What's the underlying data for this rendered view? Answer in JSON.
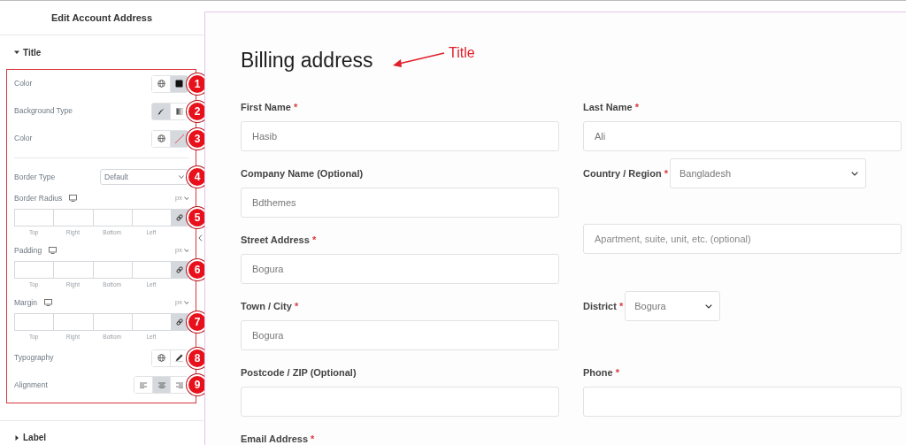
{
  "panel": {
    "title": "Edit Account Address",
    "sections": [
      {
        "label": "Title",
        "expanded": true,
        "controls": [
          {
            "kind": "toggles",
            "label": "Color",
            "callout": "1",
            "buttons": [
              {
                "kind": "global"
              },
              {
                "kind": "swatch",
                "color": "#111111"
              }
            ]
          },
          {
            "kind": "toggles",
            "label": "Background Type",
            "callout": "2",
            "buttons": [
              {
                "kind": "classic",
                "selected": true
              },
              {
                "kind": "gradient",
                "selected": false
              }
            ]
          },
          {
            "kind": "toggles",
            "label": "Color",
            "callout": "3",
            "buttons": [
              {
                "kind": "global"
              },
              {
                "kind": "empty-swatch"
              }
            ]
          },
          {
            "kind": "separator"
          },
          {
            "kind": "select",
            "label": "Border Type",
            "value": "Default",
            "callout": "4"
          },
          {
            "kind": "dimensions",
            "label": "Border Radius",
            "unit": "px",
            "sides": [
              "Top",
              "Right",
              "Bottom",
              "Left"
            ],
            "callout": "5"
          },
          {
            "kind": "dimensions",
            "label": "Padding",
            "unit": "px",
            "sides": [
              "Top",
              "Right",
              "Bottom",
              "Left"
            ],
            "callout": "6"
          },
          {
            "kind": "dimensions",
            "label": "Margin",
            "unit": "px",
            "sides": [
              "Top",
              "Right",
              "Bottom",
              "Left"
            ],
            "callout": "7"
          },
          {
            "kind": "toggles",
            "label": "Typography",
            "callout": "8",
            "buttons": [
              {
                "kind": "global"
              },
              {
                "kind": "edit"
              }
            ]
          },
          {
            "kind": "toggles",
            "label": "Alignment",
            "callout": "9",
            "buttons": [
              {
                "kind": "align-left",
                "selected": false
              },
              {
                "kind": "align-center",
                "selected": true
              },
              {
                "kind": "align-right",
                "selected": false
              }
            ]
          }
        ]
      },
      {
        "label": "Label",
        "expanded": false
      }
    ]
  },
  "form": {
    "title": "Billing address",
    "annotation": "Title",
    "rows": [
      [
        {
          "kind": "input",
          "label": "First Name",
          "required_mark": "*",
          "value": "Hasib"
        },
        {
          "kind": "input",
          "label": "Last Name",
          "required_mark": "*",
          "value": "Ali"
        }
      ],
      [
        {
          "kind": "input",
          "label": "Company Name (Optional)",
          "value": "Bdthemes"
        },
        {
          "kind": "inline-select",
          "label": "Country / Region",
          "required_mark": "*",
          "value": "Bangladesh"
        }
      ],
      [
        {
          "kind": "input",
          "label": "Street Address",
          "required_mark": "*",
          "value": "Bogura"
        },
        {
          "kind": "input",
          "placeholder": "Apartment, suite, unit, etc. (optional)"
        }
      ],
      [
        {
          "kind": "input",
          "label": "Town / City",
          "required_mark": "*",
          "value": "Bogura"
        },
        {
          "kind": "inline-select",
          "label": "District",
          "required_mark": "*",
          "value": "Bogura"
        }
      ],
      [
        {
          "kind": "input",
          "label": "Postcode / ZIP (Optional)"
        },
        {
          "kind": "input",
          "label": "Phone",
          "required_mark": "*"
        }
      ],
      [
        {
          "kind": "label-only",
          "label": "Email Address",
          "required_mark": "*"
        }
      ]
    ]
  }
}
